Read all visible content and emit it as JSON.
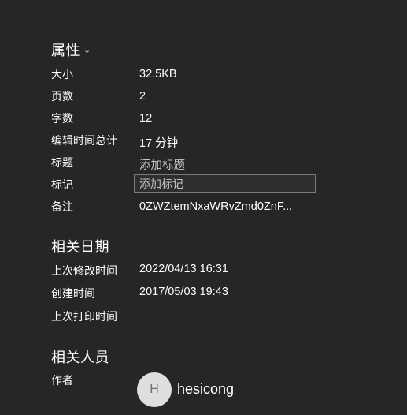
{
  "properties": {
    "title": "属性",
    "chevron": "⌄",
    "rows": [
      {
        "label": "大小",
        "value": "32.5KB"
      },
      {
        "label": "页数",
        "value": "2"
      },
      {
        "label": "字数",
        "value": "12"
      },
      {
        "label": "编辑时间总计",
        "value": "17 分钟"
      },
      {
        "label": "标题",
        "placeholder": "添加标题"
      },
      {
        "label": "标记",
        "placeholder": "添加标记"
      },
      {
        "label": "备注",
        "value": "0ZWZtemNxaWRvZmd0ZnF..."
      }
    ]
  },
  "related_dates": {
    "title": "相关日期",
    "rows": [
      {
        "label": "上次修改时间",
        "value": "2022/04/13 16:31"
      },
      {
        "label": "创建时间",
        "value": "2017/05/03 19:43"
      },
      {
        "label": "上次打印时间",
        "value": ""
      }
    ]
  },
  "related_people": {
    "title": "相关人员",
    "author_label": "作者",
    "author_initial": "H",
    "author_name": "hesicong"
  },
  "colors": {
    "background": "#262626",
    "text": "#ffffff",
    "placeholder": "#c4c4c4",
    "input_border": "#7a7a7a",
    "avatar_bg": "#dedede"
  }
}
